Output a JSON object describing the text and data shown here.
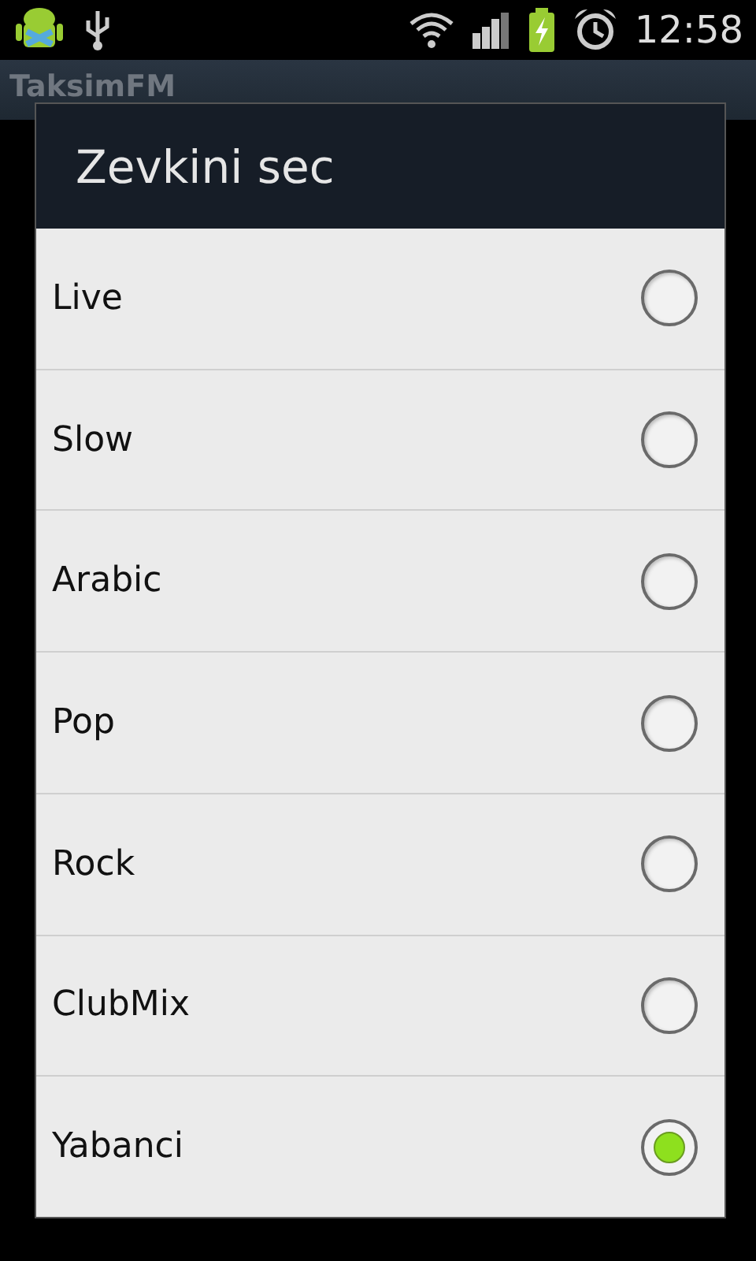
{
  "status_bar": {
    "time": "12:58"
  },
  "app_bar": {
    "title": "TaksimFM"
  },
  "dialog": {
    "title": "Zevkini sec",
    "options": [
      {
        "label": "Live",
        "selected": false
      },
      {
        "label": "Slow",
        "selected": false
      },
      {
        "label": "Arabic",
        "selected": false
      },
      {
        "label": "Pop",
        "selected": false
      },
      {
        "label": "Rock",
        "selected": false
      },
      {
        "label": "ClubMix",
        "selected": false
      },
      {
        "label": "Yabanci",
        "selected": true
      }
    ]
  }
}
